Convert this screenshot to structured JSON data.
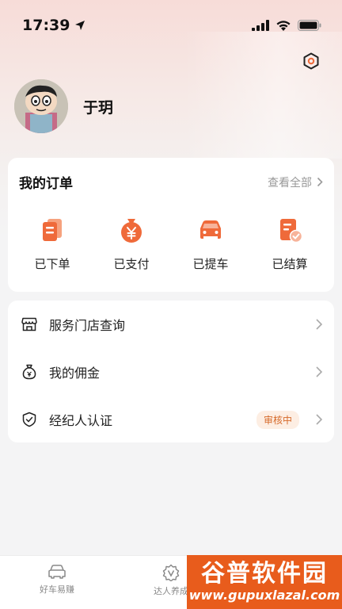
{
  "status_bar": {
    "time": "17:39"
  },
  "profile": {
    "username": "于玥"
  },
  "orders": {
    "title": "我的订单",
    "view_all": "查看全部",
    "items": [
      {
        "label": "已下单",
        "icon": "order-placed-icon"
      },
      {
        "label": "已支付",
        "icon": "money-bag-icon"
      },
      {
        "label": "已提车",
        "icon": "car-icon"
      },
      {
        "label": "已结算",
        "icon": "settled-doc-icon"
      }
    ]
  },
  "menu": {
    "items": [
      {
        "label": "服务门店查询",
        "icon": "store-icon"
      },
      {
        "label": "我的佣金",
        "icon": "money-bag-icon"
      },
      {
        "label": "经纪人认证",
        "icon": "shield-check-icon",
        "badge": "审核中"
      }
    ]
  },
  "tab_bar": {
    "tabs": [
      {
        "label": "好车易赚",
        "icon": "car-icon"
      },
      {
        "label": "达人养成",
        "icon": "badge-v-icon"
      }
    ]
  },
  "watermark": {
    "title": "谷普软件园",
    "url": "www.gupuxlazal.com"
  },
  "colors": {
    "accent": "#ef6a3a",
    "badge_text": "#d66a2a",
    "badge_bg": "#fdeee3"
  }
}
